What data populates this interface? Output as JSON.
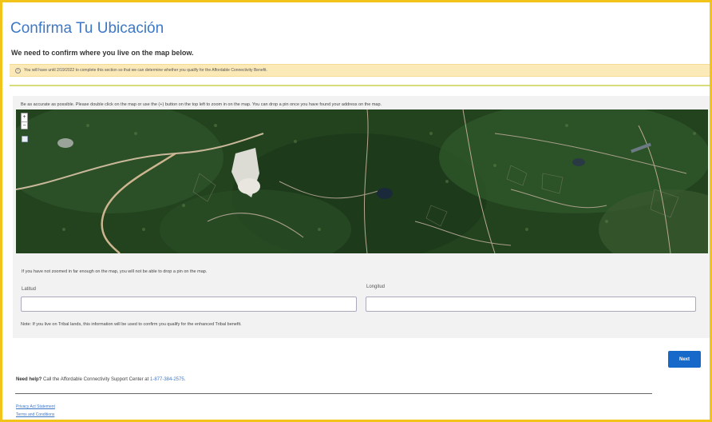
{
  "header": {
    "title": "Confirma Tu Ubicación",
    "subtitle": "We need to confirm where you live on the map below."
  },
  "alert": {
    "icon": "info-icon",
    "text": "You will have until 2/19/2022 to complete this section so that we can determine whether you qualify for the Affordable Connectivity Benefit."
  },
  "map_section": {
    "instructions": "Be as accurate as possible. Please double click on the map or use the (+) button on the top left to zoom in on the map. You can drop a pin once you have found your address on the map.",
    "zoom_in_label": "+",
    "zoom_out_label": "−",
    "zoom_note": "If you have not zoomed in far enough on the map, you will not be able to drop a pin on the map."
  },
  "form": {
    "latitude_label": "Latitud",
    "latitude_value": "",
    "longitude_label": "Longitud",
    "longitude_value": "",
    "tribal_note": "Note: If you live on Tribal lands, this information will be used to confirm you qualify for the enhanced Tribal benefit."
  },
  "actions": {
    "next_label": "Next"
  },
  "help": {
    "prefix": "Need help?",
    "text": " Call the Affordable Connectivity Support Center at ",
    "phone": "1-877-384-2575",
    "suffix": "."
  },
  "footer": {
    "privacy_label": "Privacy Act Statement",
    "terms_label": "Terms and Conditions"
  },
  "colors": {
    "frame_border": "#f2c318",
    "title": "#3d78c7",
    "alert_bg": "#fbe9b8",
    "button": "#1769c9",
    "map_green": "#2b4a26"
  }
}
